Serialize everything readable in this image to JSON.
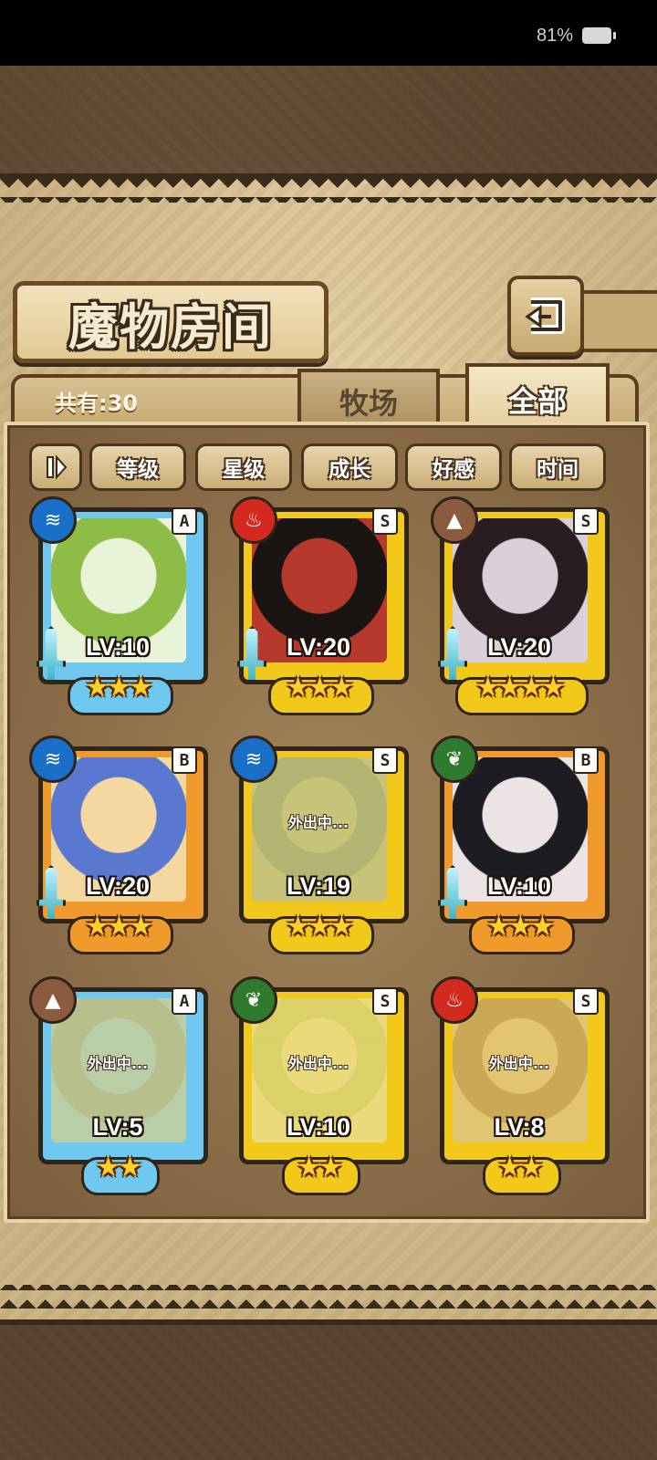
{
  "status_bar": {
    "battery": "81%"
  },
  "header": {
    "title": "魔物房间"
  },
  "tabs": {
    "count_label": "共有:30",
    "farm": "牧场",
    "all": "全部"
  },
  "filters": [
    "等级",
    "星级",
    "成长",
    "好感",
    "时间"
  ],
  "away_text": "外出中...",
  "monsters": [
    {
      "rank": "A",
      "element": "water",
      "level": "LV:10",
      "stars": "★★★",
      "away": false,
      "frame": "#6fc8ef",
      "art": "#e9f3d8",
      "hair": "#8ebd47"
    },
    {
      "rank": "S",
      "element": "fire",
      "level": "LV:20",
      "stars": "★★★",
      "away": false,
      "frame": "#f2c81a",
      "art": "#b53a2c",
      "hair": "#1a1412"
    },
    {
      "rank": "S",
      "element": "earth",
      "level": "LV:20",
      "stars": "★★★★",
      "away": false,
      "frame": "#f2c81a",
      "art": "#d9d0d9",
      "hair": "#2a1d22"
    },
    {
      "rank": "B",
      "element": "water",
      "level": "LV:20",
      "stars": "★★★",
      "away": false,
      "frame": "#f09a2c",
      "art": "#f5d8a0",
      "hair": "#5a78d0"
    },
    {
      "rank": "S",
      "element": "water",
      "level": "LV:19",
      "stars": "★★★",
      "away": true,
      "frame": "#f2c81a",
      "art": "#a8bfc8",
      "hair": "#7fa3b8"
    },
    {
      "rank": "B",
      "element": "wood",
      "level": "LV:10",
      "stars": "★★★",
      "away": false,
      "frame": "#f09a2c",
      "art": "#ece4e4",
      "hair": "#1c1c22"
    },
    {
      "rank": "A",
      "element": "earth",
      "level": "LV:5",
      "stars": "★★",
      "away": true,
      "frame": "#6fc8ef",
      "art": "#f5d26a",
      "hair": "#f2b83a"
    },
    {
      "rank": "S",
      "element": "wood",
      "level": "LV:10",
      "stars": "★★",
      "away": true,
      "frame": "#f2c81a",
      "art": "#e3e8cc",
      "hair": "#c9d7a8"
    },
    {
      "rank": "S",
      "element": "fire",
      "level": "LV:8",
      "stars": "★★",
      "away": true,
      "frame": "#f2c81a",
      "art": "#d6c2b8",
      "hair": "#a98e86"
    }
  ],
  "element_colors": {
    "water": "#1a6fc9",
    "fire": "#d22a1e",
    "earth": "#8a5b3e",
    "wood": "#2f7a2f"
  }
}
